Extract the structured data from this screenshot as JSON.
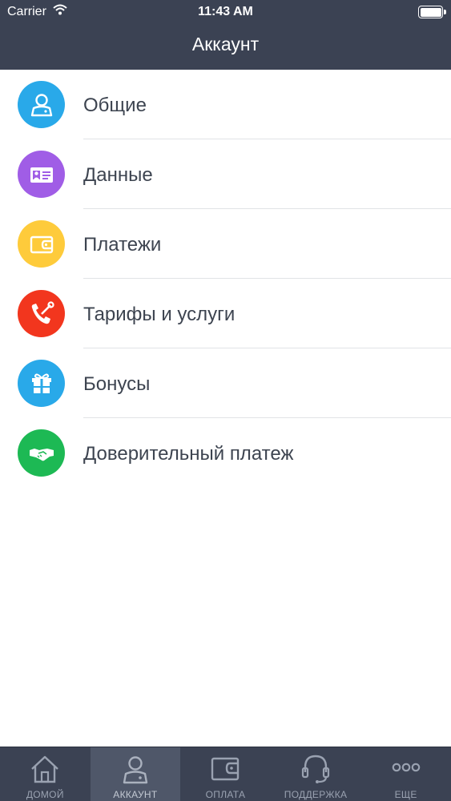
{
  "status_bar": {
    "carrier": "Carrier",
    "time": "11:43 AM"
  },
  "header": {
    "title": "Аккаунт"
  },
  "menu": {
    "items": [
      {
        "label": "Общие",
        "icon": "user-icon",
        "color": "#29a9e9"
      },
      {
        "label": "Данные",
        "icon": "id-card-icon",
        "color": "#a05de6"
      },
      {
        "label": "Платежи",
        "icon": "wallet-icon",
        "color": "#fecb3b"
      },
      {
        "label": "Тарифы и услуги",
        "icon": "phone-wrench-icon",
        "color": "#f2361e"
      },
      {
        "label": "Бонусы",
        "icon": "gift-icon",
        "color": "#29a9e9"
      },
      {
        "label": "Доверительный платеж",
        "icon": "handshake-icon",
        "color": "#1db954"
      }
    ]
  },
  "tabbar": {
    "active_index": 1,
    "tabs": [
      {
        "label": "ДОМОЙ",
        "icon": "home-icon"
      },
      {
        "label": "АККАУНТ",
        "icon": "account-icon"
      },
      {
        "label": "ОПЛАТА",
        "icon": "wallet-icon"
      },
      {
        "label": "ПОДДЕРЖКА",
        "icon": "headset-icon"
      },
      {
        "label": "ЕЩЕ",
        "icon": "more-icon"
      }
    ]
  },
  "colors": {
    "header_bg": "#3b4253",
    "tabbar_bg": "#3b4253",
    "tab_active_bg": "#4f5769"
  }
}
